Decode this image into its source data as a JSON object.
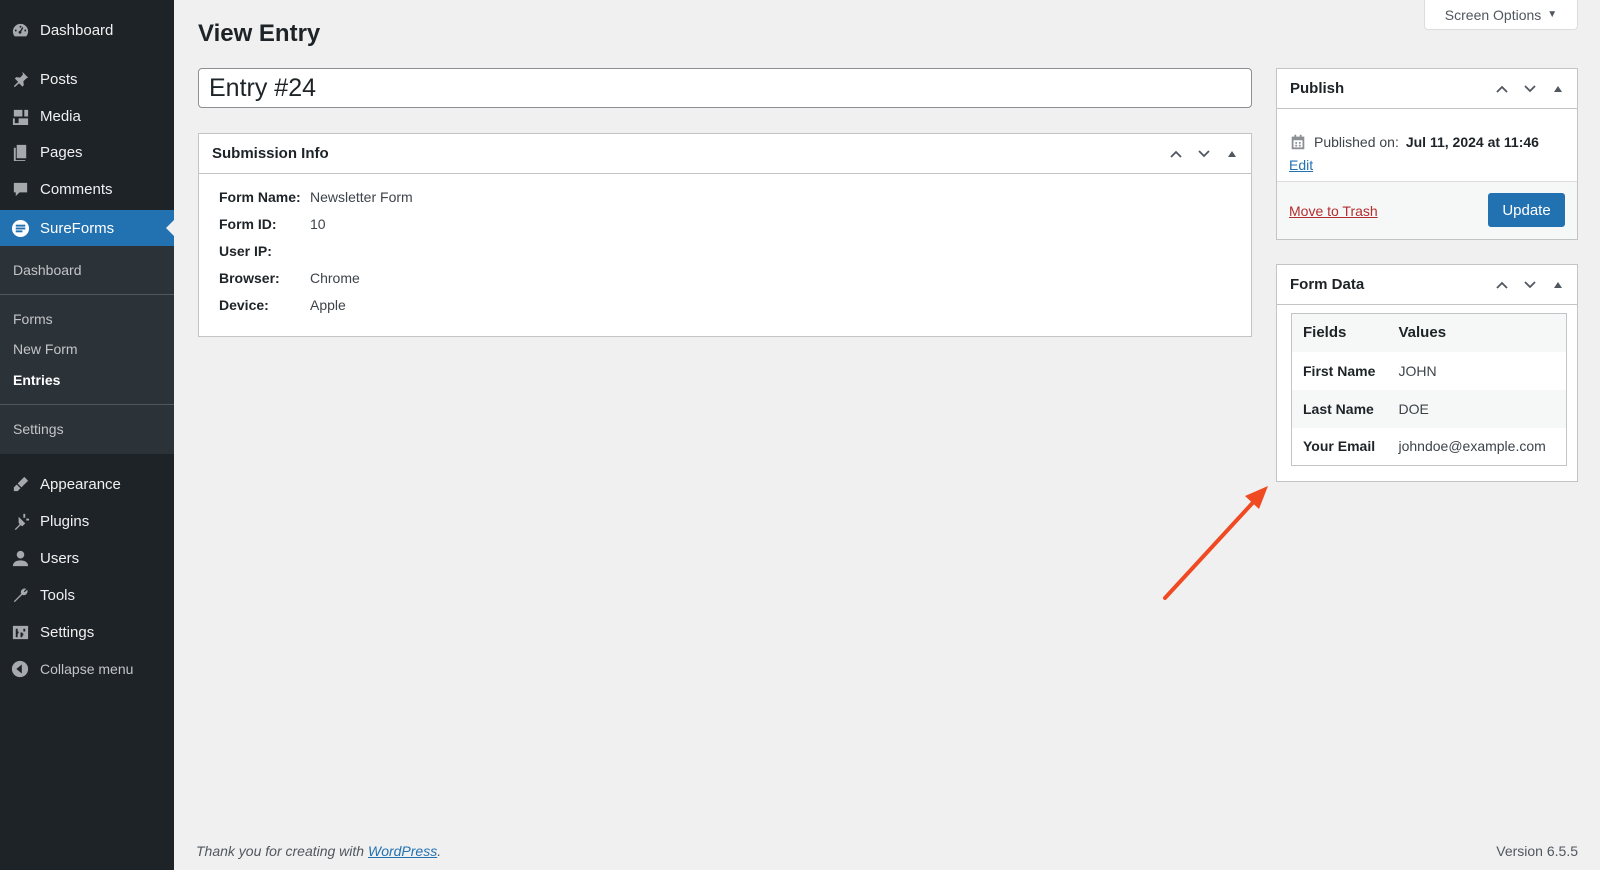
{
  "sidebar": {
    "items": [
      {
        "label": "Dashboard",
        "icon": "dashboard-icon"
      },
      {
        "label": "Posts",
        "icon": "pin-icon"
      },
      {
        "label": "Media",
        "icon": "media-icon"
      },
      {
        "label": "Pages",
        "icon": "pages-icon"
      },
      {
        "label": "Comments",
        "icon": "comment-icon"
      },
      {
        "label": "SureForms",
        "icon": "sureforms-icon"
      },
      {
        "label": "Appearance",
        "icon": "brush-icon"
      },
      {
        "label": "Plugins",
        "icon": "plug-icon"
      },
      {
        "label": "Users",
        "icon": "user-icon"
      },
      {
        "label": "Tools",
        "icon": "wrench-icon"
      },
      {
        "label": "Settings",
        "icon": "settings-icon"
      }
    ],
    "submenu": [
      "Dashboard",
      "Forms",
      "New Form",
      "Entries",
      "Settings"
    ],
    "collapse_label": "Collapse menu"
  },
  "screen_options": "Screen Options",
  "page_title": "View Entry",
  "entry_title": "Entry #24",
  "submission_info": {
    "title": "Submission Info",
    "rows": [
      {
        "label": "Form Name:",
        "value": "Newsletter Form"
      },
      {
        "label": "Form ID:",
        "value": "10"
      },
      {
        "label": "User IP:",
        "value": ""
      },
      {
        "label": "Browser:",
        "value": "Chrome"
      },
      {
        "label": "Device:",
        "value": "Apple"
      }
    ]
  },
  "publish": {
    "title": "Publish",
    "published_label": "Published on:",
    "published_date": "Jul 11, 2024 at 11:46",
    "edit": "Edit",
    "trash": "Move to Trash",
    "update": "Update"
  },
  "form_data": {
    "title": "Form Data",
    "headers": [
      "Fields",
      "Values"
    ],
    "rows": [
      [
        "First Name",
        "JOHN"
      ],
      [
        "Last Name",
        "DOE"
      ],
      [
        "Your Email",
        "johndoe@example.com"
      ]
    ]
  },
  "footer": {
    "thanks_prefix": "Thank you for creating with ",
    "wordpress": "WordPress",
    "thanks_suffix": ".",
    "version": "Version 6.5.5"
  },
  "colors": {
    "sidebar": "#1d2327",
    "accent": "#2271b1",
    "arrow": "#f04a23",
    "trash": "#b32d2e"
  }
}
